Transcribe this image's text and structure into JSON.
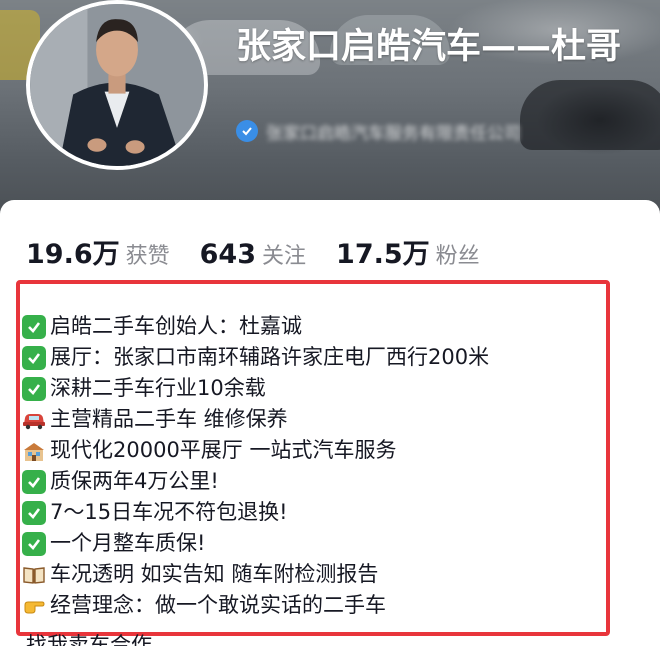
{
  "profile": {
    "title": "张家口启皓汽车——杜哥",
    "verification_text": "张家口启皓汽车服务有限责任公司",
    "verification_icon": "verified-badge-icon"
  },
  "stats": [
    {
      "value": "19.6万",
      "label": "获赞"
    },
    {
      "value": "643",
      "label": "关注"
    },
    {
      "value": "17.5万",
      "label": "粉丝"
    }
  ],
  "bio": {
    "highlight_color": "#e8353b",
    "lines": [
      {
        "icon": "check-mark-icon",
        "text": "启皓二手车创始人：杜嘉诚"
      },
      {
        "icon": "check-mark-icon",
        "text": "展厅：张家口市南环辅路许家庄电厂西行200米"
      },
      {
        "icon": "check-mark-icon",
        "text": "深耕二手车行业10余载"
      },
      {
        "icon": "car-icon",
        "text": "主营精品二手车  维修保养"
      },
      {
        "icon": "building-icon",
        "text": "现代化20000平展厅  一站式汽车服务"
      },
      {
        "icon": "check-mark-icon",
        "text": "质保两年4万公里!"
      },
      {
        "icon": "check-mark-icon",
        "text": "7～15日车况不符包退换!"
      },
      {
        "icon": "check-mark-icon",
        "text": " 一个月整车质保!"
      },
      {
        "icon": "book-icon",
        "text": "车况透明 如实告知 随车附检测报告"
      },
      {
        "icon": "pointing-hand-icon",
        "text": "经营理念：做一个敢说实话的二手车"
      }
    ],
    "cut_off_line": "找我卖车合作"
  }
}
